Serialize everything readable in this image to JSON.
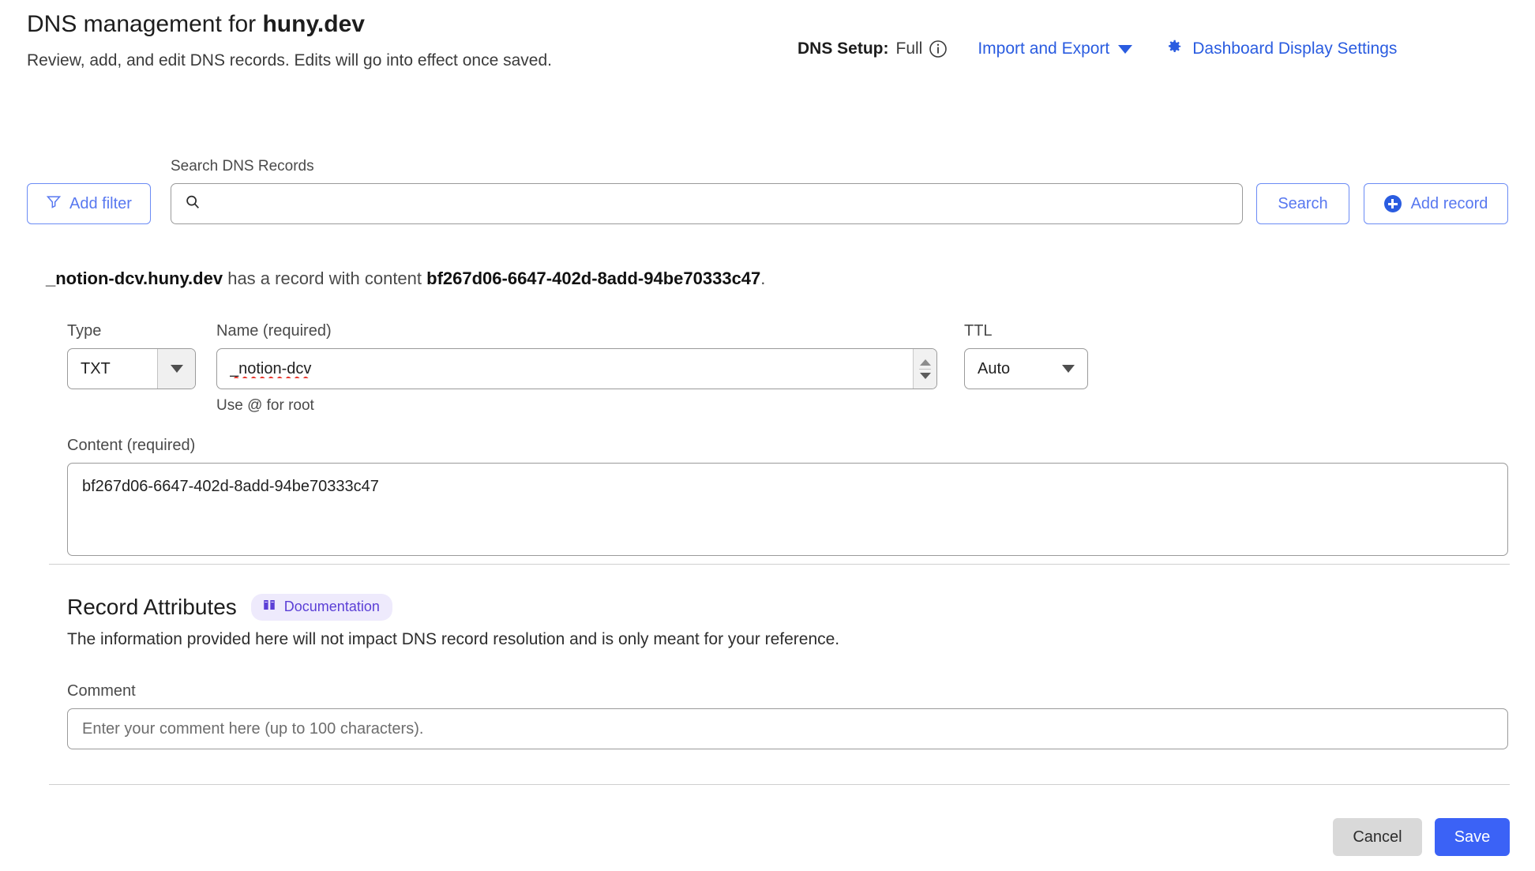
{
  "header": {
    "title_prefix": "DNS management for ",
    "domain": "huny.dev",
    "subtitle": "Review, add, and edit DNS records. Edits will go into effect once saved.",
    "dns_setup_label": "DNS Setup:",
    "dns_setup_value": "Full",
    "info_icon": "info-circle-icon",
    "import_export_label": "Import and Export",
    "dashboard_settings_label": "Dashboard Display Settings",
    "gear_icon": "gear-icon"
  },
  "toolbar": {
    "add_filter_label": "Add filter",
    "filter_icon": "filter-funnel-icon",
    "search_label": "Search DNS Records",
    "search_placeholder": "",
    "search_value": "",
    "search_icon": "magnifier-icon",
    "search_button_label": "Search",
    "add_record_label": "Add record",
    "add_record_icon": "plus-circle-icon"
  },
  "notice": {
    "record_name": "_notion-dcv.huny.dev",
    "middle": " has a record with content ",
    "record_content": "bf267d06-6647-402d-8add-94be70333c47",
    "suffix": "."
  },
  "form": {
    "type_label": "Type",
    "type_value": "TXT",
    "type_caret_icon": "triangle-down-icon",
    "name_label": "Name (required)",
    "name_value": "_notion-dcv",
    "name_hint": "Use @ for root",
    "spinner_up_icon": "triangle-up-icon",
    "spinner_down_icon": "triangle-down-icon",
    "ttl_label": "TTL",
    "ttl_value": "Auto",
    "ttl_caret_icon": "triangle-down-icon",
    "content_label": "Content (required)",
    "content_value": "bf267d06-6647-402d-8add-94be70333c47"
  },
  "attributes": {
    "title": "Record Attributes",
    "documentation_badge": "Documentation",
    "documentation_icon": "book-icon",
    "description": "The information provided here will not impact DNS record resolution and is only meant for your reference.",
    "comment_label": "Comment",
    "comment_value": "",
    "comment_placeholder": "Enter your comment here (up to 100 characters)."
  },
  "footer": {
    "cancel_label": "Cancel",
    "save_label": "Save"
  },
  "colors": {
    "accent_blue": "#2a5ce0",
    "button_blue": "#3b62f6",
    "link_blue": "#5878f0",
    "badge_bg": "#eeeafc",
    "badge_text": "#5b3fd6",
    "cancel_gray": "#d9d9d9",
    "spell_error": "#e8342a"
  }
}
